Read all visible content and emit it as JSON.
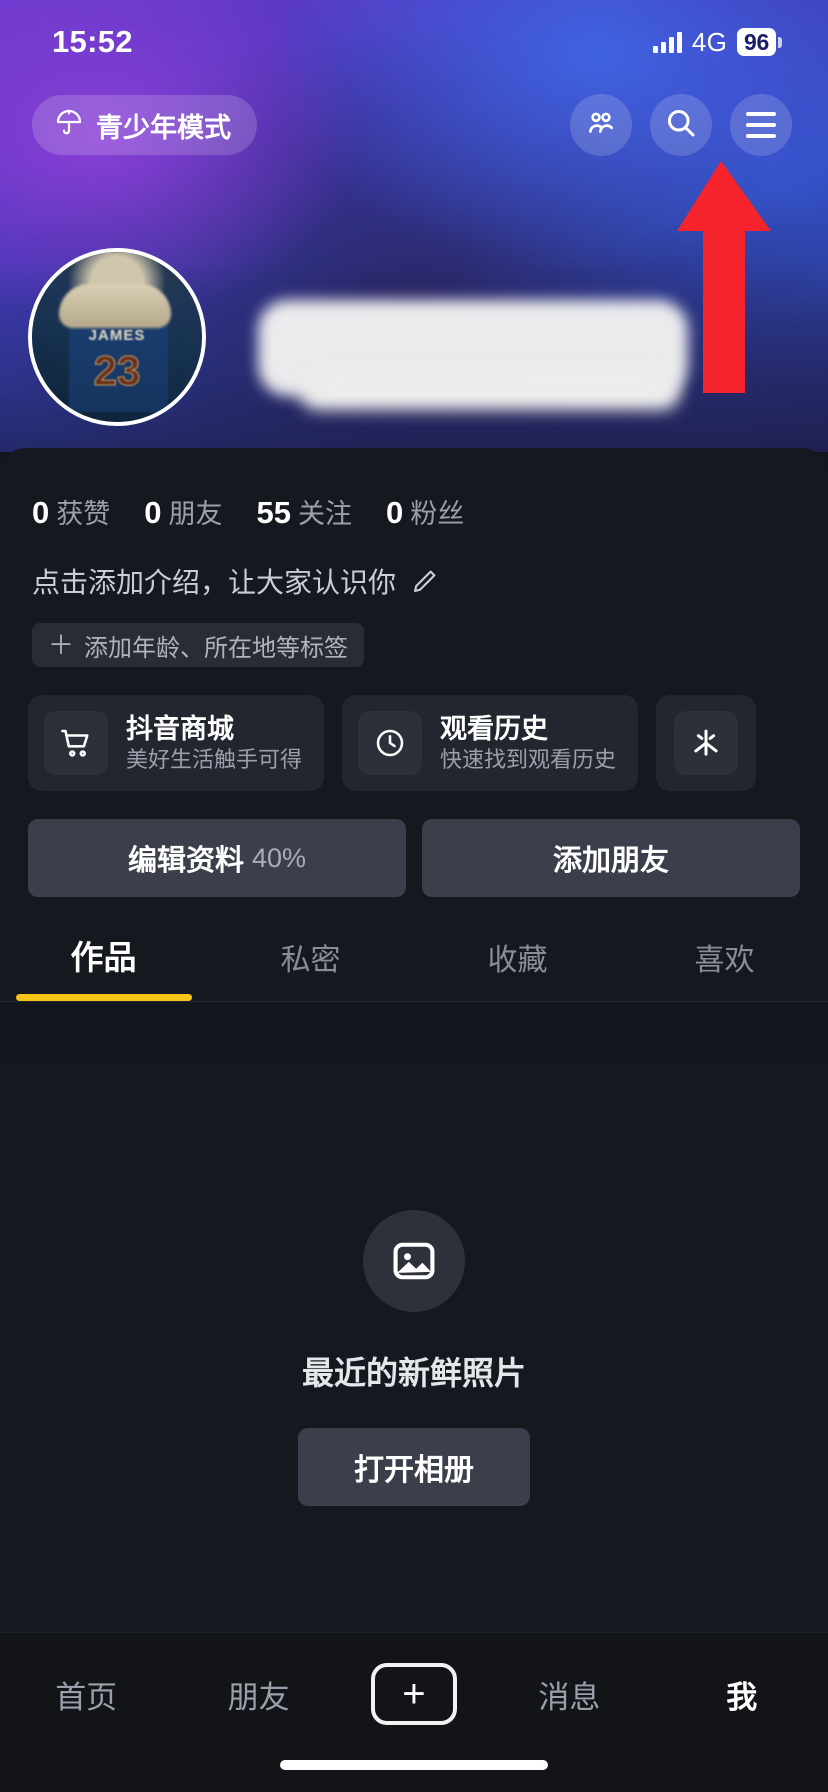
{
  "status_bar": {
    "time": "15:52",
    "network": "4G",
    "battery": "96",
    "signal_icon": "signal-bars-icon",
    "battery_icon": "battery-icon"
  },
  "top_nav": {
    "teen_mode_label": "青少年模式",
    "teen_mode_icon": "umbrella-icon",
    "friends_icon": "people-icon",
    "search_icon": "search-icon",
    "menu_icon": "hamburger-menu-icon"
  },
  "annotation": {
    "arrow_icon": "red-arrow-up-icon",
    "color": "#f5232c"
  },
  "profile": {
    "avatar_icon": "user-avatar",
    "avatar_jersey_name": "JAMES",
    "avatar_jersey_number": "23",
    "stats": [
      {
        "value": "0",
        "label": "获赞"
      },
      {
        "value": "0",
        "label": "朋友"
      },
      {
        "value": "55",
        "label": "关注"
      },
      {
        "value": "0",
        "label": "粉丝"
      }
    ],
    "bio_placeholder": "点击添加介绍，让大家认识你",
    "bio_edit_icon": "pencil-icon",
    "tag_plus": "＋",
    "tag_label": "添加年龄、所在地等标签"
  },
  "shortcut_cards": [
    {
      "title": "抖音商城",
      "subtitle": "美好生活触手可得",
      "icon": "shopping-cart-icon"
    },
    {
      "title": "观看历史",
      "subtitle": "快速找到观看历史",
      "icon": "clock-icon"
    },
    {
      "title": "",
      "subtitle": "",
      "icon": "douyin-coin-icon"
    }
  ],
  "actions": {
    "edit_profile_label": "编辑资料",
    "edit_profile_percent": "40%",
    "add_friend_label": "添加朋友"
  },
  "tabs": [
    {
      "label": "作品",
      "active": true
    },
    {
      "label": "私密",
      "active": false
    },
    {
      "label": "收藏",
      "active": false
    },
    {
      "label": "喜欢",
      "active": false
    }
  ],
  "empty_state": {
    "icon": "photo-image-icon",
    "text": "最近的新鲜照片",
    "button_label": "打开相册"
  },
  "bottom_nav": {
    "items": [
      {
        "label": "首页",
        "active": false
      },
      {
        "label": "朋友",
        "active": false
      },
      {
        "label": "",
        "active": false,
        "icon": "plus-create-icon"
      },
      {
        "label": "消息",
        "active": false
      },
      {
        "label": "我",
        "active": true
      }
    ]
  },
  "colors": {
    "accent_tab": "#f5c518",
    "sheet_bg": "#15181f",
    "card_bg": "#22262f",
    "button_bg": "#3a3f4b",
    "arrow": "#f5232c"
  }
}
